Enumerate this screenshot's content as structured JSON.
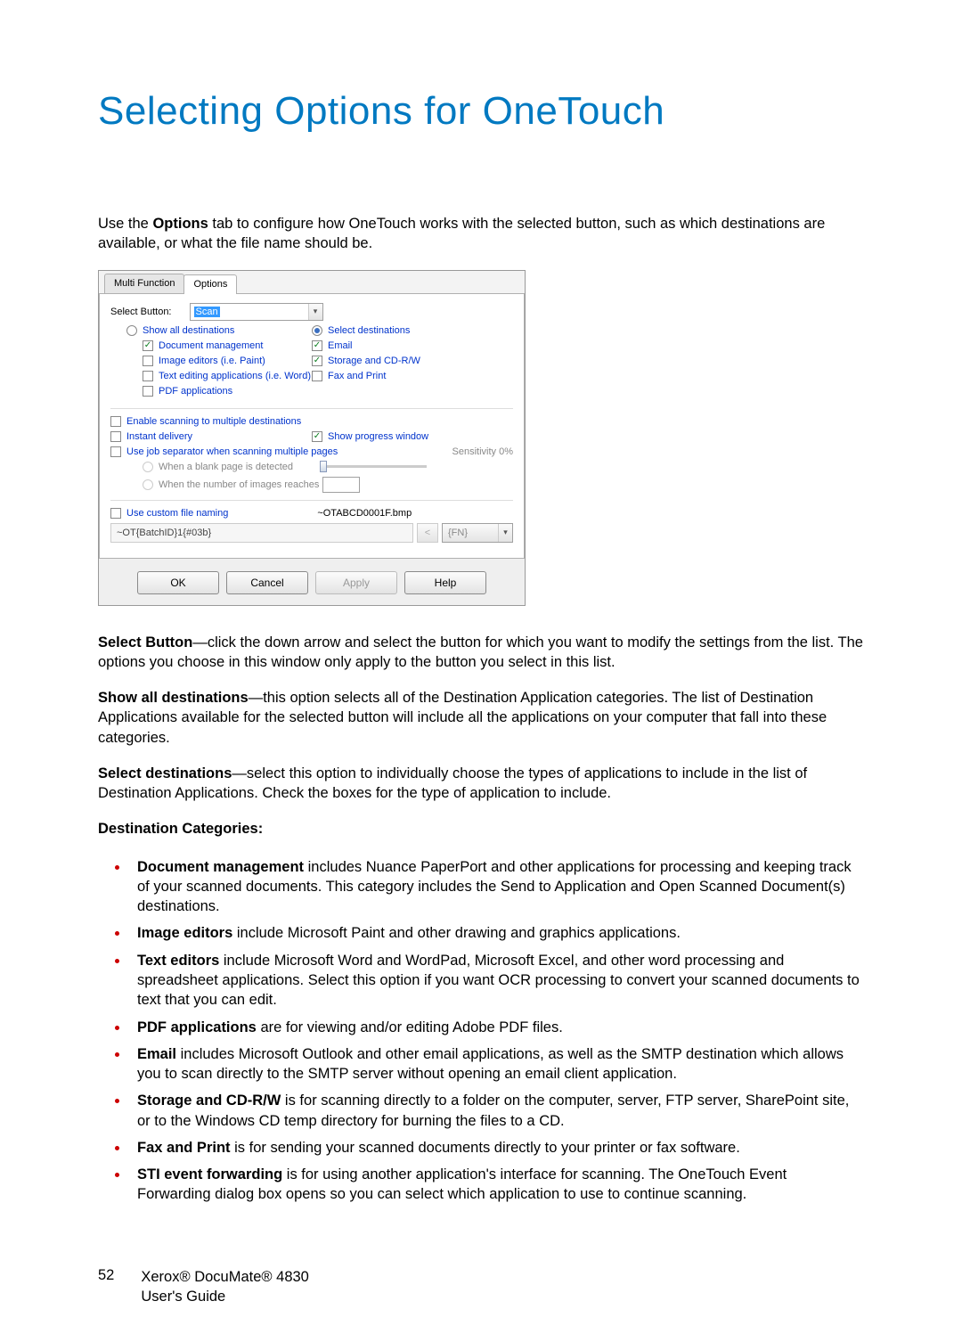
{
  "title": "Selecting Options for OneTouch",
  "intro": {
    "pre": "Use the ",
    "bold": "Options",
    "post": " tab to configure how OneTouch works with the selected button, such as which destinations are available, or what the file name should be."
  },
  "para_select_button": {
    "bold": "Select Button",
    "rest": "—click the down arrow and select the button for which you want to modify the settings from the list. The options you choose in this window only apply to the button you select in this list."
  },
  "para_show_all": {
    "bold": "Show all destinations",
    "rest": "—this option selects all of the Destination Application categories. The list of Destination Applications available for the selected button will include all the applications on your computer that fall into these categories."
  },
  "para_select_dest": {
    "bold": "Select destinations",
    "rest": "—select this option to individually choose the types of applications to include in the list of Destination Applications. Check the boxes for the type of application to include."
  },
  "dest_cat_heading": "Destination Categories:",
  "bullets": [
    {
      "bold": "Document management",
      "rest": " includes Nuance PaperPort and other applications for processing and keeping track of your scanned documents. This category includes the Send to Application and Open Scanned Document(s) destinations."
    },
    {
      "bold": "Image editors",
      "rest": " include Microsoft Paint and other drawing and graphics applications."
    },
    {
      "bold": "Text editors",
      "rest": " include Microsoft Word and WordPad, Microsoft Excel, and other word processing and spreadsheet applications. Select this option if you want OCR processing to convert your scanned documents to text that you can edit."
    },
    {
      "bold": "PDF applications",
      "rest": " are for viewing and/or editing Adobe PDF files."
    },
    {
      "bold": "Email",
      "rest": " includes Microsoft Outlook and other email applications, as well as the SMTP destination which allows you to scan directly to the SMTP server without opening an email client application."
    },
    {
      "bold": "Storage and CD-R/W",
      "rest": " is for scanning directly to a folder on the computer, server, FTP server, SharePoint site, or to the Windows CD temp directory for burning the files to a CD."
    },
    {
      "bold": "Fax and Print",
      "rest": " is for sending your scanned documents directly to your printer or fax software."
    },
    {
      "bold": "STI event forwarding",
      "rest": " is for using another application's interface for scanning. The OneTouch Event Forwarding dialog box opens so you can select which application to use to continue scanning."
    }
  ],
  "footer": {
    "page": "52",
    "line1": "Xerox® DocuMate® 4830",
    "line2": "User's Guide"
  },
  "dialog": {
    "tabs": {
      "multi": "Multi Function",
      "options": "Options"
    },
    "select_button_label": "Select Button:",
    "select_button_value": "Scan",
    "radio_show_all": "Show all destinations",
    "radio_select": "Select destinations",
    "cb_doc_mgmt": "Document management",
    "cb_email": "Email",
    "cb_img_editors": "Image editors (i.e. Paint)",
    "cb_storage": "Storage and CD-R/W",
    "cb_text_editors": "Text editing applications (i.e. Word)",
    "cb_faxprint": "Fax and Print",
    "cb_pdf": "PDF applications",
    "cb_enable_multi": "Enable scanning to multiple destinations",
    "cb_instant_delivery": "Instant delivery",
    "cb_show_progress": "Show progress window",
    "cb_job_sep": "Use job separator when scanning multiple pages",
    "sensitivity_label": "Sensitivity  0%",
    "rb_blank": "When a blank page is detected",
    "rb_imgcount": "When the number of images reaches",
    "cb_custom_name": "Use custom file naming",
    "filename_preview": "~OTABCD0001F.bmp",
    "custom_name_value": "~OT{BatchID}1{#03b}",
    "back_label": "<",
    "token_label": "{FN}",
    "btn_ok": "OK",
    "btn_cancel": "Cancel",
    "btn_apply": "Apply",
    "btn_help": "Help"
  }
}
